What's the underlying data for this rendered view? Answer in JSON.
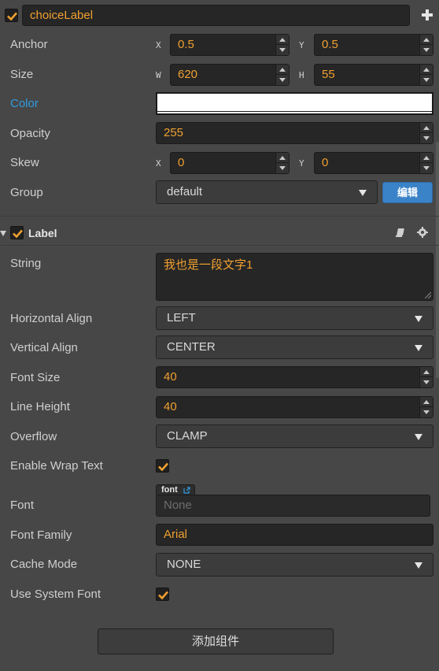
{
  "node": {
    "name": "choiceLabel"
  },
  "transform": {
    "anchor": {
      "label": "Anchor",
      "x_axis": "X",
      "x": "0.5",
      "y_axis": "Y",
      "y": "0.5"
    },
    "size": {
      "label": "Size",
      "w_axis": "W",
      "w": "620",
      "h_axis": "H",
      "h": "55"
    },
    "color": {
      "label": "Color",
      "value": "#ffffff"
    },
    "opacity": {
      "label": "Opacity",
      "value": "255"
    },
    "skew": {
      "label": "Skew",
      "x_axis": "X",
      "x": "0",
      "y_axis": "Y",
      "y": "0"
    },
    "group": {
      "label": "Group",
      "value": "default",
      "edit_button": "编辑"
    }
  },
  "label_component": {
    "title": "Label",
    "string": {
      "label": "String",
      "value": "我也是一段文字1"
    },
    "horizontal_align": {
      "label": "Horizontal Align",
      "value": "LEFT"
    },
    "vertical_align": {
      "label": "Vertical Align",
      "value": "CENTER"
    },
    "font_size": {
      "label": "Font Size",
      "value": "40"
    },
    "line_height": {
      "label": "Line Height",
      "value": "40"
    },
    "overflow": {
      "label": "Overflow",
      "value": "CLAMP"
    },
    "enable_wrap_text": {
      "label": "Enable Wrap Text"
    },
    "font": {
      "label": "Font",
      "tag": "font",
      "placeholder": "None"
    },
    "font_family": {
      "label": "Font Family",
      "value": "Arial"
    },
    "cache_mode": {
      "label": "Cache Mode",
      "value": "NONE"
    },
    "use_system_font": {
      "label": "Use System Font"
    }
  },
  "add_component_button": "添加组件",
  "colors": {
    "accent": "#f0a030",
    "link": "#2f9bdf",
    "button_blue": "#3b83c8",
    "panel": "#474747"
  }
}
